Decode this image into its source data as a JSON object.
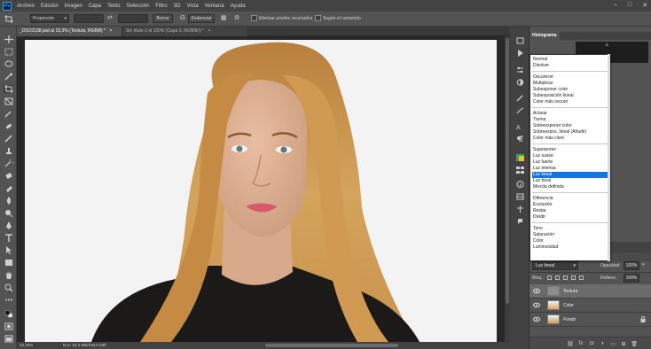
{
  "menu": {
    "logo": "Ps",
    "items": [
      "Archivo",
      "Edición",
      "Imagen",
      "Capa",
      "Texto",
      "Selección",
      "Filtro",
      "3D",
      "Vista",
      "Ventana",
      "Ayuda"
    ],
    "window_controls": [
      "–",
      "□",
      "✕"
    ]
  },
  "options_bar": {
    "style_value": "Proporción",
    "swap_icon": "swap-arrows-icon",
    "clear_button": "Borrar",
    "straighten_button": "Enderezar",
    "delete_cropped_label": "Eliminar píxeles recortados",
    "content_aware_label": "Según el contenido"
  },
  "tabs": [
    {
      "label": "_DSC0138.psd al 33,3% (Textura, RGB/8) *",
      "close": "×"
    },
    {
      "label": "Sin título-3 al 100% (Capa 2, RGB/8#) *",
      "close": "×"
    }
  ],
  "status": {
    "zoom": "33,33%",
    "doc": "Doc: 53,3 MB/198,9 MB"
  },
  "histogram": {
    "tab_label": "Histograma",
    "warning": "⚠"
  },
  "blend_modes": {
    "groups": [
      [
        "Normal",
        "Disolver"
      ],
      [
        "Oscurecer",
        "Multiplicar",
        "Subexponer color",
        "Subexposición lineal",
        "Color más oscuro"
      ],
      [
        "Aclarar",
        "Trama",
        "Sobreexponer color",
        "Sobreexpos. lineal (Añadir)",
        "Color más claro"
      ],
      [
        "Superponer",
        "Luz suave",
        "Luz fuerte",
        "Luz intensa",
        "Luz lineal",
        "Luz focal",
        "Mezcla definida"
      ],
      [
        "Diferencia",
        "Exclusión",
        "Restar",
        "Dividir"
      ],
      [
        "Tono",
        "Saturación",
        "Color",
        "Luminosidad"
      ]
    ],
    "selected": "Luz lineal"
  },
  "layers": {
    "blend_value": "Luz lineal",
    "opacity_label": "Opacidad:",
    "opacity_value": "100%",
    "lock_label": "Bloq.:",
    "fill_label": "Relleno:",
    "fill_value": "100%",
    "items": [
      {
        "name": "Textura",
        "selected": true,
        "italic": false
      },
      {
        "name": "Color",
        "selected": false,
        "italic": false
      },
      {
        "name": "Fondo",
        "selected": false,
        "italic": true,
        "locked": true
      }
    ],
    "footer_icons": [
      "link-icon",
      "fx-icon",
      "mask-icon",
      "adjustment-icon",
      "folder-icon",
      "new-layer-icon",
      "trash-icon"
    ],
    "footer_fx_text": "fx"
  }
}
